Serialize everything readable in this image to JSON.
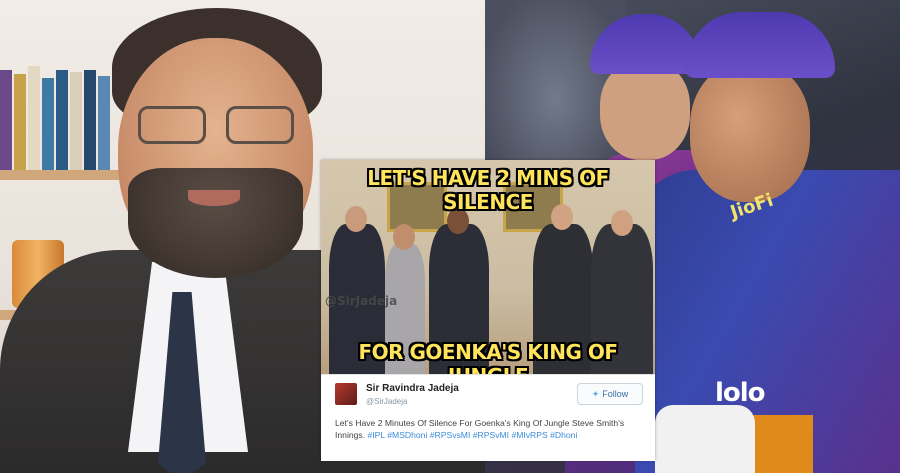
{
  "meme": {
    "top_text": "LET'S HAVE 2 MINS OF SILENCE",
    "bottom_text": "FOR GOENKA'S KING OF JUNGLE",
    "watermark": "@SirJadeja"
  },
  "tweet": {
    "name": "Sir Ravindra Jadeja",
    "handle": "@SirJadeja",
    "follow_label": "Follow",
    "text": "Let's Have 2 Minutes Of Silence For Goenka's King Of Jungle Steve Smith's Innings.",
    "hashtags": [
      "#IPL",
      "#MSDhoni",
      "#RPSvsMI",
      "#RPSvMI",
      "#MIvRPS",
      "#Dhoni"
    ]
  },
  "jersey": {
    "sponsor_1": "JioFi",
    "sponsor_2": "lolo"
  },
  "colors": {
    "meme_text": "#ffe45c",
    "hashtag": "#3b8bd9",
    "twitter_blue": "#55acee"
  }
}
